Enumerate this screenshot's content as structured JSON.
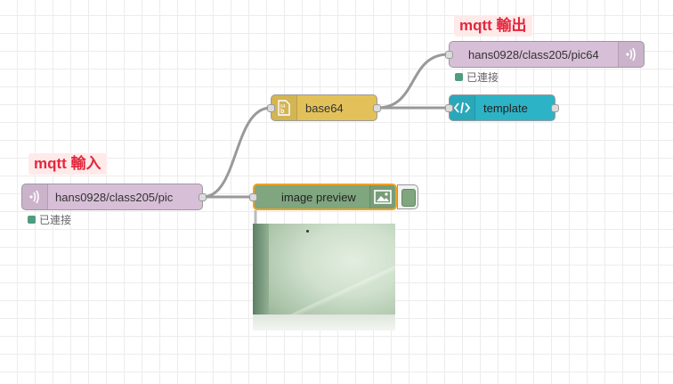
{
  "canvas": {
    "tags": {
      "mqtt_in": "mqtt 輸入",
      "mqtt_out": "mqtt 輸出"
    }
  },
  "nodes": {
    "mqtt_in": {
      "label": "hans0928/class205/pic",
      "status": "已連接",
      "icon": "wifi-waves-icon",
      "color": "#d8bfd8"
    },
    "base64": {
      "label": "base64",
      "icon": "base64-file-icon",
      "color": "#e2c15a"
    },
    "mqtt_out": {
      "label": "hans0928/class205/pic64",
      "status": "已連接",
      "icon": "wifi-waves-icon",
      "color": "#d8bfd8"
    },
    "template": {
      "label": "template",
      "icon": "code-brackets-icon",
      "color": "#2db3c6"
    },
    "image_preview": {
      "label": "image preview",
      "icon": "image-icon",
      "color": "#7fa67f"
    }
  },
  "status_color": "#4f9d80",
  "wire_color": "#999999"
}
